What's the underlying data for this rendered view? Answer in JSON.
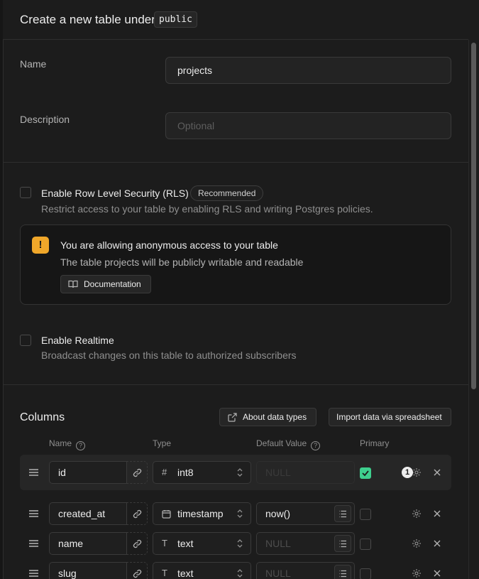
{
  "header": {
    "title": "Create a new table under",
    "schema": "public"
  },
  "form": {
    "name_label": "Name",
    "name_value": "projects",
    "description_label": "Description",
    "description_placeholder": "Optional"
  },
  "rls": {
    "title": "Enable Row Level Security (RLS)",
    "badge": "Recommended",
    "description": "Restrict access to your table by enabling RLS and writing Postgres policies.",
    "checked": false
  },
  "alert": {
    "title": "You are allowing anonymous access to your table",
    "description": "The table projects will be publicly writable and readable",
    "button": "Documentation"
  },
  "realtime": {
    "title": "Enable Realtime",
    "description": "Broadcast changes on this table to authorized subscribers",
    "checked": false
  },
  "columns": {
    "title": "Columns",
    "about_button": "About data types",
    "import_button": "Import data via spreadsheet",
    "headers": {
      "name": "Name",
      "type": "Type",
      "default": "Default Value",
      "primary": "Primary"
    },
    "rows": [
      {
        "name": "id",
        "type": "int8",
        "type_icon": "#",
        "default": "NULL",
        "primary": true
      },
      {
        "name": "created_at",
        "type": "timestamp",
        "type_icon": "calendar-icon",
        "default": "now()",
        "primary": false
      },
      {
        "name": "name",
        "type": "text",
        "type_icon": "T",
        "default": "NULL",
        "primary": false
      },
      {
        "name": "slug",
        "type": "text",
        "type_icon": "T",
        "default": "NULL",
        "primary": false
      }
    ],
    "settings_badge": "1"
  },
  "colors": {
    "accent": "#3ecf8e",
    "warning": "#f0a72a",
    "background": "#1c1c1c"
  }
}
